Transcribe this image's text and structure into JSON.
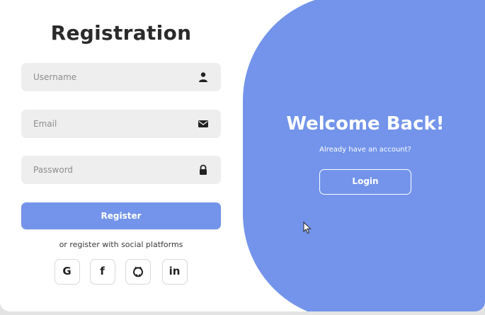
{
  "form": {
    "title": "Registration",
    "username_placeholder": "Username",
    "email_placeholder": "Email",
    "password_placeholder": "Password",
    "register_label": "Register",
    "social_text": "or register with social platforms",
    "social": [
      {
        "label": "G",
        "icon": "google-icon"
      },
      {
        "label": "f",
        "icon": "facebook-icon"
      },
      {
        "label": "",
        "icon": "github-icon"
      },
      {
        "label": "in",
        "icon": "linkedin-icon"
      }
    ]
  },
  "panel": {
    "heading": "Welcome Back!",
    "subtext": "Already have an account?",
    "login_label": "Login"
  },
  "colors": {
    "accent": "#7394ea",
    "field_bg": "#eeeeee",
    "text_dark": "#2a2a2a"
  }
}
